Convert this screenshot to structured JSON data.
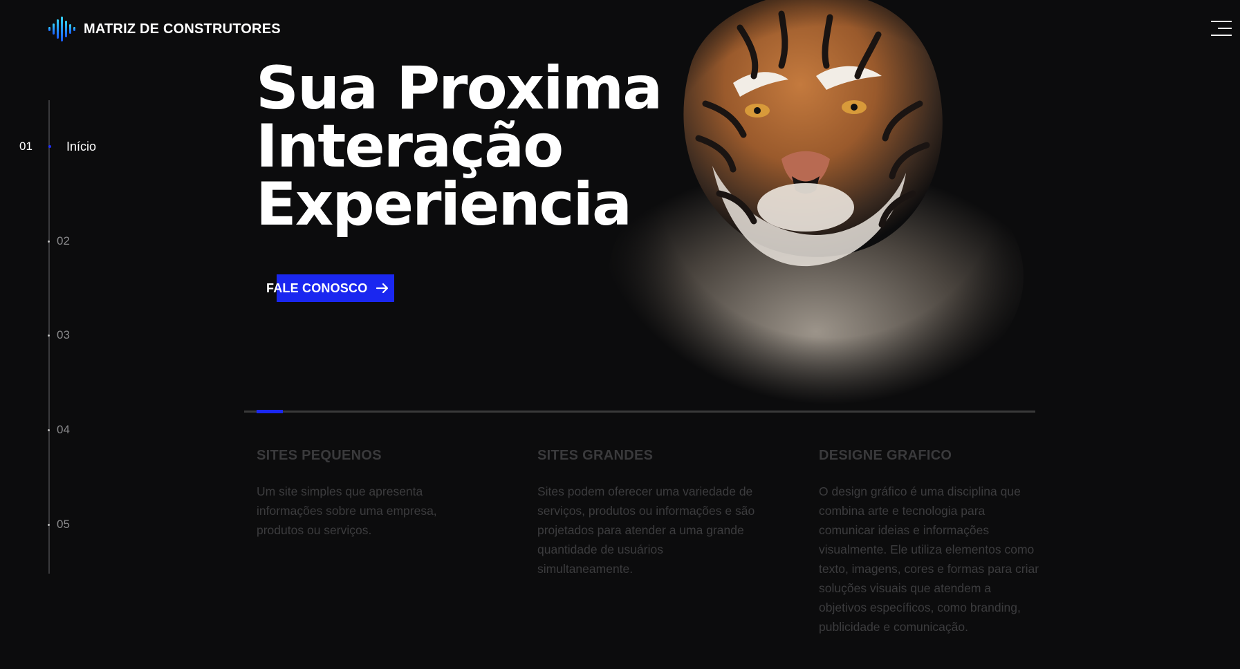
{
  "brand": {
    "name": "MATRIZ DE CONSTRUTORES",
    "icon": "soundwave-logo-icon"
  },
  "header": {
    "menu_icon": "hamburger-menu-icon"
  },
  "vertical_nav": {
    "items": [
      {
        "num": "01",
        "label": "Início",
        "active": true
      },
      {
        "num": "02",
        "label": "",
        "active": false
      },
      {
        "num": "03",
        "label": "",
        "active": false
      },
      {
        "num": "04",
        "label": "",
        "active": false
      },
      {
        "num": "05",
        "label": "",
        "active": false
      }
    ]
  },
  "hero": {
    "title_lines": [
      "Sua Proxima",
      "Interação",
      "Experiencia"
    ],
    "cta_label": "FALE CONOSCO",
    "cta_icon": "arrow-right-icon",
    "image": "tiger-portrait"
  },
  "slider": {
    "progress": 0.033
  },
  "services": [
    {
      "title": "SITES PEQUENOS",
      "text": "Um site simples que apresenta informações sobre uma empresa, produtos ou serviços."
    },
    {
      "title": "SITES GRANDES",
      "text": "Sites podem oferecer uma variedade de serviços, produtos ou informações e são projetados para atender a uma grande quantidade de usuários simultaneamente."
    },
    {
      "title": "DESIGNE GRAFICO",
      "text": "O design gráfico é uma disciplina que combina arte e tecnologia para comunicar ideias e informações visualmente. Ele utiliza elementos como texto, imagens, cores e formas para criar soluções visuais que atendem a objetivos específicos, como branding, publicidade e comunicação."
    }
  ],
  "colors": {
    "accent": "#1a27f0",
    "background": "#0c0c0d",
    "muted_text": "#3c3c3e"
  }
}
